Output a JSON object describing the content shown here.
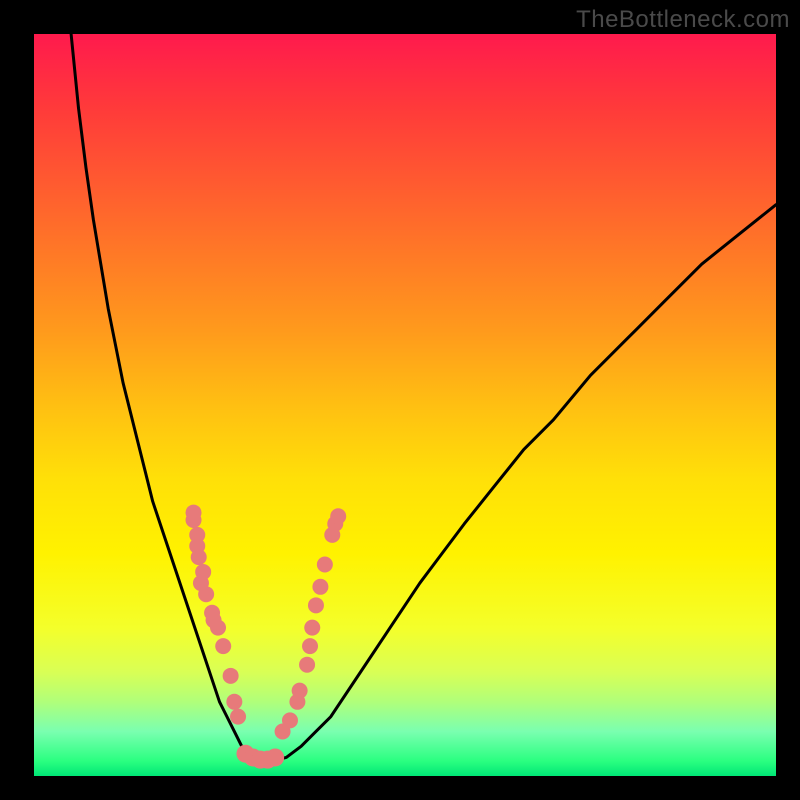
{
  "watermark": "TheBottleneck.com",
  "chart_data": {
    "type": "line",
    "title": "",
    "xlabel": "",
    "ylabel": "",
    "xlim": [
      0,
      100
    ],
    "ylim": [
      0,
      100
    ],
    "curve": {
      "name": "bottleneck-curve",
      "x": [
        5,
        6,
        7,
        8,
        9,
        10,
        11,
        12,
        13,
        14,
        15,
        16,
        17,
        18,
        19,
        20,
        21,
        22,
        23,
        24,
        25,
        26,
        27,
        28,
        29,
        30,
        32,
        34,
        36,
        38,
        40,
        42,
        44,
        46,
        48,
        50,
        52,
        55,
        58,
        62,
        66,
        70,
        75,
        80,
        85,
        90,
        95,
        100
      ],
      "y": [
        100,
        90,
        82,
        75,
        69,
        63,
        58,
        53,
        49,
        45,
        41,
        37,
        34,
        31,
        28,
        25,
        22,
        19,
        16,
        13,
        10,
        8,
        6,
        4,
        2.5,
        2,
        2,
        2.5,
        4,
        6,
        8,
        11,
        14,
        17,
        20,
        23,
        26,
        30,
        34,
        39,
        44,
        48,
        54,
        59,
        64,
        69,
        73,
        77
      ]
    },
    "points_left": {
      "name": "left-cluster",
      "color": "#e77a7a",
      "data": [
        {
          "x": 21.5,
          "y": 35.5
        },
        {
          "x": 21.5,
          "y": 34.5
        },
        {
          "x": 22.0,
          "y": 32.5
        },
        {
          "x": 22.0,
          "y": 31.0
        },
        {
          "x": 22.2,
          "y": 29.5
        },
        {
          "x": 22.8,
          "y": 27.5
        },
        {
          "x": 22.5,
          "y": 26.0
        },
        {
          "x": 23.2,
          "y": 24.5
        },
        {
          "x": 24.0,
          "y": 22.0
        },
        {
          "x": 24.2,
          "y": 21.0
        },
        {
          "x": 24.8,
          "y": 20.0
        },
        {
          "x": 25.5,
          "y": 17.5
        },
        {
          "x": 26.5,
          "y": 13.5
        },
        {
          "x": 27.0,
          "y": 10.0
        },
        {
          "x": 27.5,
          "y": 8.0
        }
      ]
    },
    "points_right": {
      "name": "right-cluster",
      "color": "#e77a7a",
      "data": [
        {
          "x": 33.5,
          "y": 6.0
        },
        {
          "x": 34.5,
          "y": 7.5
        },
        {
          "x": 35.5,
          "y": 10.0
        },
        {
          "x": 35.8,
          "y": 11.5
        },
        {
          "x": 36.8,
          "y": 15.0
        },
        {
          "x": 37.2,
          "y": 17.5
        },
        {
          "x": 37.5,
          "y": 20.0
        },
        {
          "x": 38.0,
          "y": 23.0
        },
        {
          "x": 38.6,
          "y": 25.5
        },
        {
          "x": 39.2,
          "y": 28.5
        },
        {
          "x": 40.2,
          "y": 32.5
        },
        {
          "x": 40.6,
          "y": 34.0
        },
        {
          "x": 41.0,
          "y": 35.0
        }
      ]
    },
    "points_bottom": {
      "name": "bottom-cluster",
      "color": "#e77a7a",
      "data": [
        {
          "x": 28.5,
          "y": 3.0
        },
        {
          "x": 29.5,
          "y": 2.5
        },
        {
          "x": 30.5,
          "y": 2.2
        },
        {
          "x": 31.5,
          "y": 2.2
        },
        {
          "x": 32.5,
          "y": 2.5
        }
      ]
    },
    "colors": {
      "curve_stroke": "#000000",
      "point_fill": "#e77a7a",
      "background_top": "#ff1a4d",
      "background_bottom": "#00e676",
      "frame": "#000000"
    }
  }
}
